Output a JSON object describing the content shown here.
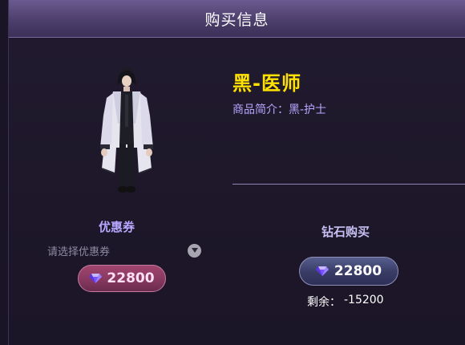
{
  "dialog": {
    "title": "购买信息"
  },
  "item": {
    "name": "黑-医师",
    "description": "商品简介：黑-护士",
    "portrait_icon": "character-portrait"
  },
  "coupon": {
    "title": "优惠券",
    "placeholder": "请选择优惠券",
    "dropdown_icon": "chevron-down-icon",
    "price": "22800",
    "price_icon": "diamond-icon"
  },
  "purchase": {
    "title": "钻石购买",
    "price": "22800",
    "price_icon": "diamond-icon",
    "remaining_label": "剩余：",
    "remaining_value": "-15200"
  },
  "colors": {
    "title_yellow": "#ffe200",
    "accent_purple": "#b7a7ff",
    "coupon_pink": "#8a3a62",
    "buy_blue": "#3a3e68"
  }
}
